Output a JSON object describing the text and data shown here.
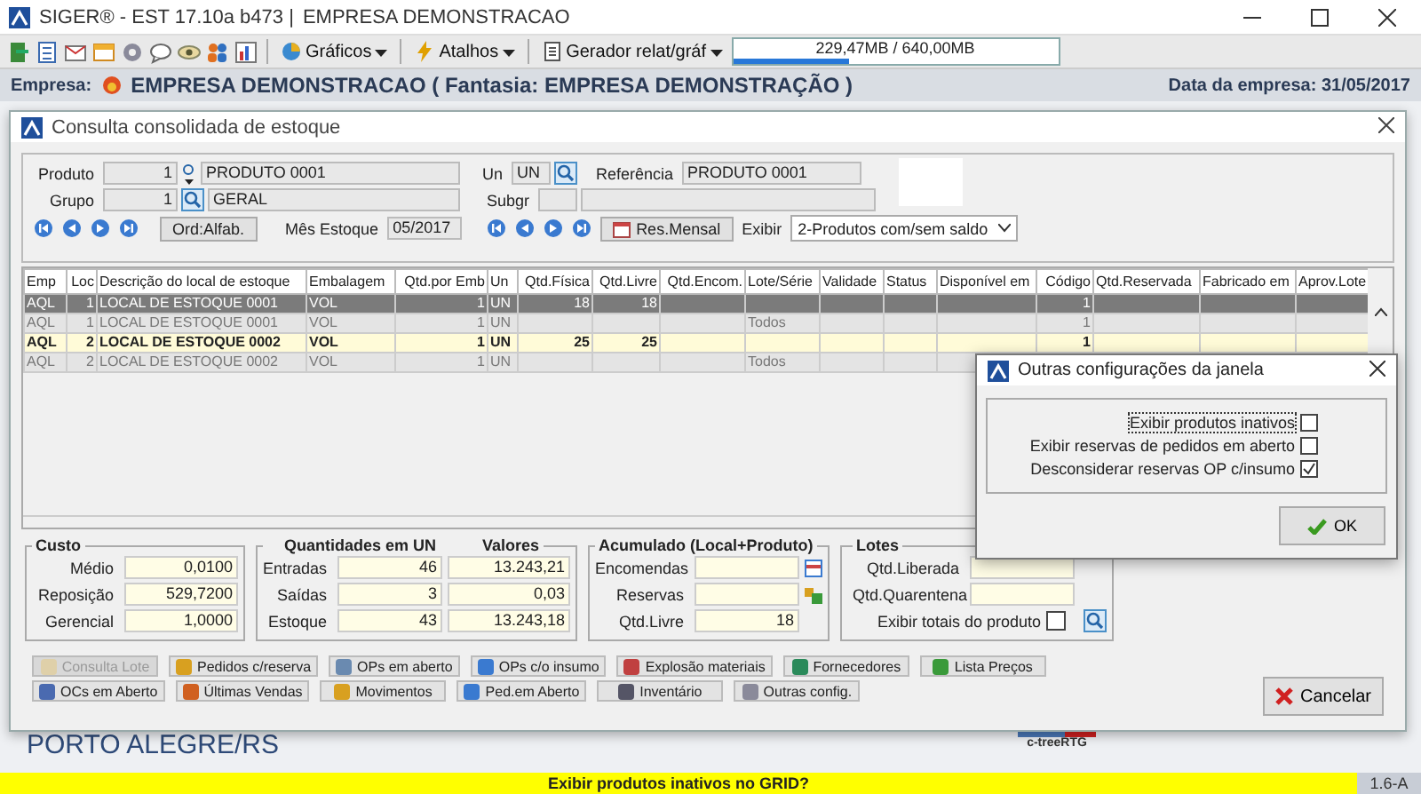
{
  "app": {
    "title": "SIGER® - EST 17.10a b473 |",
    "company_title": "EMPRESA DEMONSTRACAO"
  },
  "toolbar": {
    "menus": [
      "Gráficos",
      "Atalhos",
      "Gerador relat/gráf"
    ],
    "memory": {
      "reading": "229,47MB / 640,00MB",
      "level": 0.36
    }
  },
  "company_bar": {
    "label": "Empresa:",
    "name": "EMPRESA DEMONSTRACAO ( Fantasia: EMPRESA DEMONSTRAÇÃO )",
    "date": "Data da empresa: 31/05/2017"
  },
  "window": {
    "title": "Consulta consolidada de estoque",
    "filters": {
      "produto": {
        "label": "Produto",
        "code": "1",
        "name": "PRODUTO 0001"
      },
      "grupo": {
        "label": "Grupo",
        "code": "1",
        "name": "GERAL"
      },
      "un": {
        "label": "Un",
        "value": "UN"
      },
      "referencia": {
        "label": "Referência",
        "value": "PRODUTO 0001"
      },
      "subgr": {
        "label": "Subgr"
      },
      "order_button": "Ord:Alfab.",
      "month": {
        "label": "Mês Estoque",
        "value": "05/2017"
      },
      "summary_button": "Res.Mensal",
      "show": {
        "label": "Exibir",
        "value": "2-Produtos com/sem saldo"
      }
    },
    "table": {
      "columns": [
        "Emp",
        "Loc",
        "Descrição do local de estoque",
        "Embalagem",
        "Qtd.por Emb",
        "Un",
        "Qtd.Física",
        "Qtd.Livre",
        "Qtd.Encom.",
        "Lote/Série",
        "Validade",
        "Status",
        "Disponível em",
        "Código",
        "Qtd.Reservada",
        "Fabricado em",
        "Aprov.Lote"
      ],
      "rows": [
        {
          "kind": "stock",
          "selected": true,
          "cells": [
            "AQL",
            "1",
            "LOCAL DE ESTOQUE 0001",
            "VOL",
            "1",
            "UN",
            "18",
            "18",
            null,
            null,
            null,
            null,
            null,
            "1",
            null,
            null,
            null
          ]
        },
        {
          "kind": "lot-total",
          "selected": false,
          "cells": [
            "AQL",
            "1",
            "LOCAL DE ESTOQUE 0001",
            "VOL",
            "1",
            "UN",
            null,
            null,
            null,
            "Todos",
            null,
            null,
            null,
            "1",
            null,
            null,
            null
          ]
        },
        {
          "kind": "stock",
          "selected": false,
          "cells": [
            "AQL",
            "2",
            "LOCAL DE ESTOQUE 0002",
            "VOL",
            "1",
            "UN",
            "25",
            "25",
            null,
            null,
            null,
            null,
            null,
            "1",
            null,
            null,
            null
          ]
        },
        {
          "kind": "lot-total",
          "selected": false,
          "cells": [
            "AQL",
            "2",
            "LOCAL DE ESTOQUE 0002",
            "VOL",
            "1",
            "UN",
            null,
            null,
            null,
            "Todos",
            null,
            null,
            null,
            null,
            null,
            null,
            null
          ]
        }
      ]
    },
    "custo": {
      "title": "Custo",
      "fields": [
        {
          "label": "Médio",
          "value": "0,0100"
        },
        {
          "label": "Reposição",
          "value": "529,7200"
        },
        {
          "label": "Gerencial",
          "value": "1,0000"
        }
      ]
    },
    "quantities": {
      "title": "Quantidades em UN",
      "values_title": "Valores",
      "rows": [
        {
          "label": "Entradas",
          "qty": "46",
          "value": "13.243,21"
        },
        {
          "label": "Saídas",
          "qty": "3",
          "value": "0,03"
        },
        {
          "label": "Estoque",
          "qty": "43",
          "value": "13.243,18"
        }
      ]
    },
    "accumulated": {
      "title": "Acumulado (Local+Produto)",
      "fields": [
        {
          "label": "Encomendas"
        },
        {
          "label": "Reservas"
        },
        {
          "label": "Qtd.Livre",
          "value": "18"
        }
      ]
    },
    "lots": {
      "title": "Lotes",
      "fields": [
        {
          "label": "Qtd.Liberada"
        },
        {
          "label": "Qtd.Quarentena"
        }
      ],
      "show_totals": {
        "label": "Exibir totais do produto",
        "checked": false
      }
    },
    "button_rows": [
      [
        {
          "label": "Consulta Lote",
          "disabled": true
        },
        {
          "label": "Pedidos c/reserva",
          "disabled": false
        },
        {
          "label": "OPs em aberto",
          "disabled": false
        },
        {
          "label": "OPs c/o insumo",
          "disabled": false
        },
        {
          "label": "Explosão materiais",
          "disabled": false
        },
        {
          "label": "Fornecedores",
          "disabled": false
        },
        {
          "label": "Lista Preços",
          "disabled": false
        }
      ],
      [
        {
          "label": "OCs em Aberto",
          "disabled": false
        },
        {
          "label": "Últimas Vendas",
          "disabled": false
        },
        {
          "label": "Movimentos",
          "disabled": false
        },
        {
          "label": "Ped.em Aberto",
          "disabled": false
        },
        {
          "label": "Inventário",
          "disabled": false
        },
        {
          "label": "Outras config.",
          "disabled": false
        }
      ]
    ],
    "cancel_button": "Cancelar"
  },
  "background": {
    "location": "PORTO ALEGRE/RS",
    "logo": "c-treeRTG"
  },
  "dialog": {
    "title": "Outras configurações da janela",
    "options": [
      {
        "label": "Exibir produtos inativos",
        "checked": false
      },
      {
        "label": "Exibir reservas de pedidos em aberto",
        "checked": false
      },
      {
        "label": "Desconsiderar reservas OP c/insumo",
        "checked": true
      }
    ],
    "ok_button": "OK"
  },
  "status_bar": {
    "message": "Exibir produtos inativos no GRID?",
    "version": "1.6-A"
  }
}
